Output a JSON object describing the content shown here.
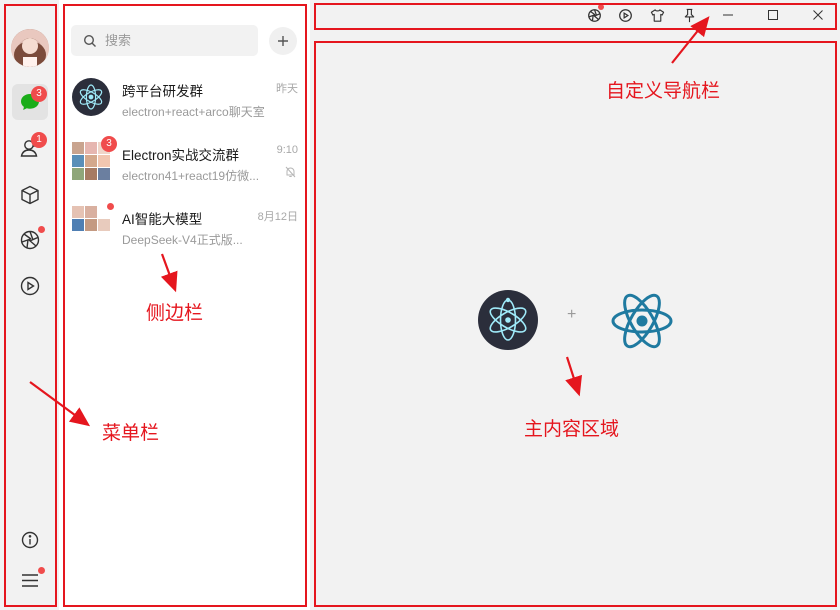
{
  "menu": {
    "items": [
      {
        "name": "chat",
        "icon": "chat-bubble-icon",
        "badge": "3",
        "active": true
      },
      {
        "name": "contacts",
        "icon": "contact-icon",
        "badge": "1"
      },
      {
        "name": "cube",
        "icon": "cube-icon"
      },
      {
        "name": "moments",
        "icon": "aperture-icon",
        "dot": true
      },
      {
        "name": "video",
        "icon": "play-circle-icon"
      }
    ],
    "bottom": [
      {
        "name": "about",
        "icon": "info-icon"
      },
      {
        "name": "more",
        "icon": "hamburger-menu-icon",
        "dot": true
      }
    ]
  },
  "sidebar": {
    "search_placeholder": "搜索",
    "chats": [
      {
        "title": "跨平台研发群",
        "subtitle": "electron+react+arco聊天室",
        "time": "昨天"
      },
      {
        "title": "Electron实战交流群",
        "subtitle": "electron41+react19仿微...",
        "time": "9:10",
        "badge": "3",
        "muted": true
      },
      {
        "title": "AI智能大模型",
        "subtitle": "DeepSeek-V4正式版...",
        "time": "8月12日",
        "dot": true
      }
    ]
  },
  "titlebar": {
    "icons": [
      "aperture-icon",
      "play-circle-icon",
      "tshirt-icon",
      "pin-icon",
      "minimize-icon",
      "maximize-icon",
      "close-icon"
    ]
  },
  "main": {
    "plus": "+"
  },
  "annotations": {
    "titlebar": "自定义导航栏",
    "sidebar": "侧边栏",
    "menubar": "菜单栏",
    "main": "主内容区域"
  },
  "colors": {
    "annotation_red": "#e5161e",
    "badge_red": "#f04c4c",
    "electron_dark": "#2b2e3b",
    "electron_cyan": "#9feaf9",
    "react_blue": "#1f7aa0"
  }
}
